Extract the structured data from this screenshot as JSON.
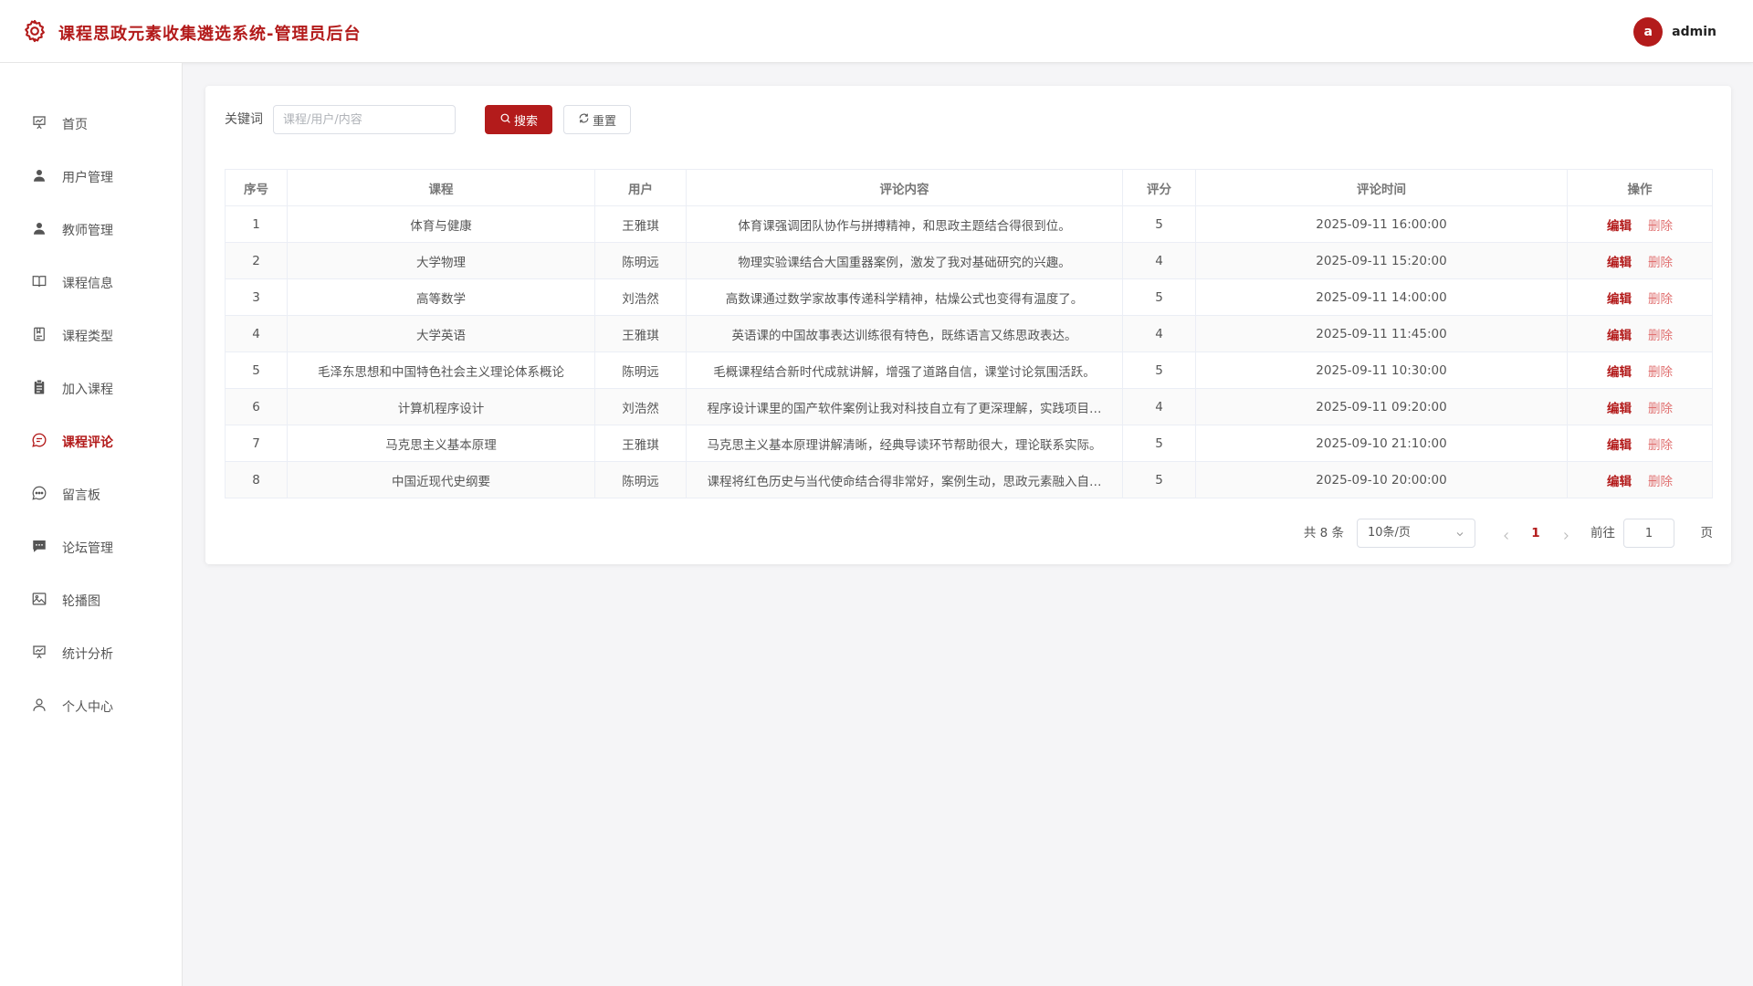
{
  "app": {
    "title": "课程思政元素收集遴选系统-管理员后台",
    "brand_icon": "gear-icon"
  },
  "user": {
    "avatar_letter": "a",
    "name": "admin"
  },
  "sidebar": {
    "items": [
      {
        "label": "首页",
        "icon": "presentation-icon"
      },
      {
        "label": "用户管理",
        "icon": "user-icon"
      },
      {
        "label": "教师管理",
        "icon": "user-icon"
      },
      {
        "label": "课程信息",
        "icon": "book-icon"
      },
      {
        "label": "课程类型",
        "icon": "notebook-icon"
      },
      {
        "label": "加入课程",
        "icon": "clipboard-icon"
      },
      {
        "label": "课程评论",
        "icon": "chat-icon",
        "active": true
      },
      {
        "label": "留言板",
        "icon": "chat-dots-icon"
      },
      {
        "label": "论坛管理",
        "icon": "message-icon"
      },
      {
        "label": "轮播图",
        "icon": "picture-icon"
      },
      {
        "label": "统计分析",
        "icon": "presentation-icon"
      },
      {
        "label": "个人中心",
        "icon": "user-outline-icon"
      }
    ]
  },
  "search": {
    "label": "关键词",
    "placeholder": "课程/用户/内容",
    "value": "",
    "search_label": "搜索",
    "reset_label": "重置"
  },
  "table": {
    "headers": [
      "序号",
      "课程",
      "用户",
      "评论内容",
      "评分",
      "评论时间",
      "操作"
    ],
    "edit_label": "编辑",
    "delete_label": "删除",
    "rows": [
      [
        "1",
        "体育与健康",
        "王雅琪",
        "体育课强调团队协作与拼搏精神，和思政主题结合得很到位。",
        "5",
        "2025-09-11 16:00:00"
      ],
      [
        "2",
        "大学物理",
        "陈明远",
        "物理实验课结合大国重器案例，激发了我对基础研究的兴趣。",
        "4",
        "2025-09-11 15:20:00"
      ],
      [
        "3",
        "高等数学",
        "刘浩然",
        "高数课通过数学家故事传递科学精神，枯燥公式也变得有温度了。",
        "5",
        "2025-09-11 14:00:00"
      ],
      [
        "4",
        "大学英语",
        "王雅琪",
        "英语课的中国故事表达训练很有特色，既练语言又练思政表达。",
        "4",
        "2025-09-11 11:45:00"
      ],
      [
        "5",
        "毛泽东思想和中国特色社会主义理论体系概论",
        "陈明远",
        "毛概课程结合新时代成就讲解，增强了道路自信，课堂讨论氛围活跃。",
        "5",
        "2025-09-11 10:30:00"
      ],
      [
        "6",
        "计算机程序设计",
        "刘浩然",
        "程序设计课里的国产软件案例让我对科技自立有了更深理解，实践项目…",
        "4",
        "2025-09-11 09:20:00"
      ],
      [
        "7",
        "马克思主义基本原理",
        "王雅琪",
        "马克思主义基本原理讲解清晰，经典导读环节帮助很大，理论联系实际。",
        "5",
        "2025-09-10 21:10:00"
      ],
      [
        "8",
        "中国近现代史纲要",
        "陈明远",
        "课程将红色历史与当代使命结合得非常好，案例生动，思政元素融入自…",
        "5",
        "2025-09-10 20:00:00"
      ]
    ]
  },
  "pagination": {
    "total_text": "共 8 条",
    "page_size": "10条/页",
    "current_page": "1",
    "goto_label": "前往",
    "goto_value": "1",
    "page_suffix": "页"
  },
  "colors": {
    "accent": "#b31b1b",
    "delete": "#e07070"
  }
}
